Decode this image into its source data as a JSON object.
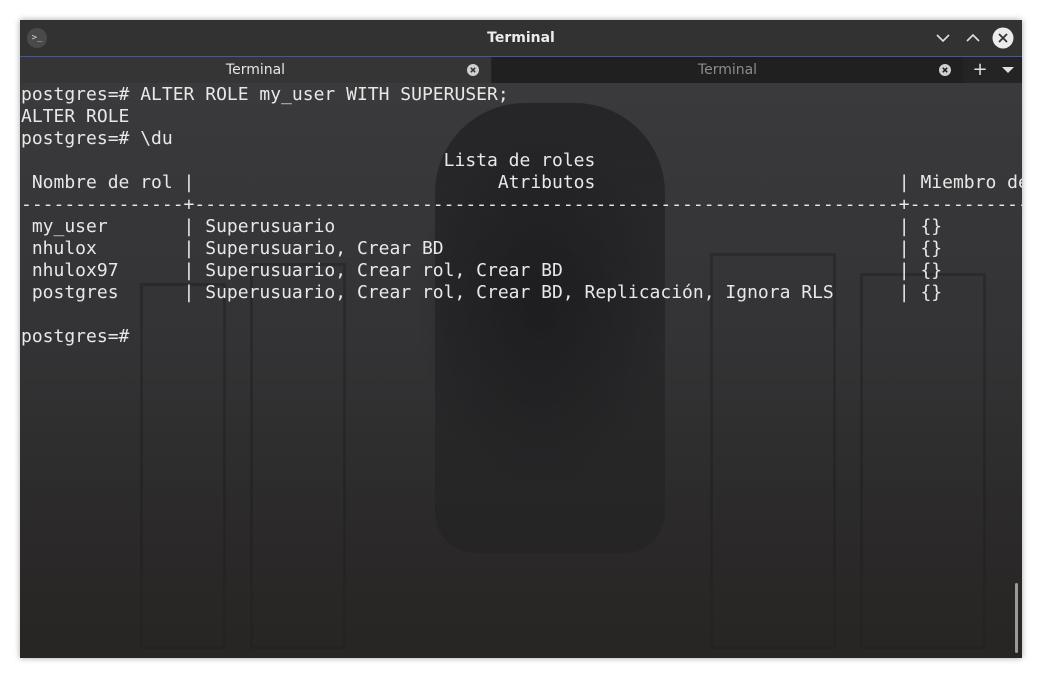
{
  "window": {
    "title": "Terminal",
    "app_icon_glyph": ">_"
  },
  "tabs": [
    {
      "label": "Terminal",
      "active": true
    },
    {
      "label": "Terminal",
      "active": false
    }
  ],
  "tab_add_glyph": "+",
  "terminal": {
    "lines": [
      "postgres=# ALTER ROLE my_user WITH SUPERUSER;",
      "ALTER ROLE",
      "postgres=# \\du",
      "                                       Lista de roles",
      " Nombre de rol |                            Atributos                            | Miembro de",
      "---------------+-----------------------------------------------------------------+------------",
      " my_user       | Superusuario                                                    | {}",
      " nhulox        | Superusuario, Crear BD                                          | {}",
      " nhulox97      | Superusuario, Crear rol, Crear BD                               | {}",
      " postgres      | Superusuario, Crear rol, Crear BD, Replicación, Ignora RLS      | {}",
      "",
      "postgres=#"
    ]
  },
  "colors": {
    "title_bar": "#323232",
    "accent_line": "#3b5aa8",
    "terminal_text": "#e8e8e8"
  }
}
